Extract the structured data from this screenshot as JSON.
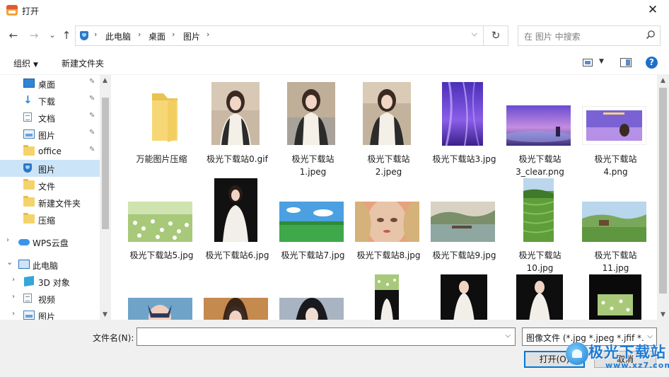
{
  "window": {
    "title": "打开",
    "close_glyph": "✕"
  },
  "nav": {
    "back_glyph": "←",
    "forward_glyph": "→",
    "recent_glyph": "⌄",
    "up_glyph": "↑",
    "breadcrumb": [
      "此电脑",
      "桌面",
      "图片"
    ],
    "crumb_sep": "›",
    "address_dropdown_glyph": "⌵",
    "refresh_glyph": "↻",
    "search_placeholder": "在 图片 中搜索"
  },
  "toolbar": {
    "organize_label": "组织",
    "new_folder_label": "新建文件夹",
    "help_label": "?"
  },
  "sidebar": {
    "items": [
      {
        "label": "桌面",
        "icon": "desktop-icon",
        "pinned": true
      },
      {
        "label": "下载",
        "icon": "download-icon",
        "pinned": true
      },
      {
        "label": "文档",
        "icon": "document-icon",
        "pinned": true
      },
      {
        "label": "图片",
        "icon": "pictures-icon",
        "pinned": true
      },
      {
        "label": "office",
        "icon": "folder-icon",
        "pinned": true
      },
      {
        "label": "图片",
        "icon": "shield-folder-icon",
        "selected": true
      },
      {
        "label": "文件",
        "icon": "folder-icon"
      },
      {
        "label": "新建文件夹",
        "icon": "folder-icon"
      },
      {
        "label": "压缩",
        "icon": "folder-icon"
      },
      {
        "label": "WPS云盘",
        "icon": "cloud-icon",
        "expandable": true
      },
      {
        "label": "此电脑",
        "icon": "computer-icon",
        "expanded": true
      },
      {
        "label": "3D 对象",
        "icon": "cube-icon",
        "expandable": true
      },
      {
        "label": "视频",
        "icon": "video-icon",
        "expandable": true
      },
      {
        "label": "图片",
        "icon": "pictures-icon",
        "expandable": true
      }
    ],
    "pin_glyph": "📌",
    "expand_glyph": "›",
    "collapse_glyph": "⌄"
  },
  "files": [
    {
      "name": "万能图片压缩",
      "kind": "folder"
    },
    {
      "name": "极光下载站0.gif",
      "kind": "photo-portrait"
    },
    {
      "name": "极光下载站\n1.jpeg",
      "kind": "photo-portrait"
    },
    {
      "name": "极光下载站\n2.jpeg",
      "kind": "photo-portrait"
    },
    {
      "name": "极光下载站3.jpg",
      "kind": "purple-sky"
    },
    {
      "name": "极光下载站\n3_clear.png",
      "kind": "purple-landscape"
    },
    {
      "name": "极光下载站\n4.png",
      "kind": "purple-card"
    },
    {
      "name": "极光下载站5.jpg",
      "kind": "flower-field"
    },
    {
      "name": "极光下载站6.jpg",
      "kind": "dark-portrait"
    },
    {
      "name": "极光下载站7.jpg",
      "kind": "anime-field"
    },
    {
      "name": "极光下载站8.jpg",
      "kind": "face-closeup"
    },
    {
      "name": "极光下载站9.jpg",
      "kind": "lake"
    },
    {
      "name": "极光下载站\n10.jpg",
      "kind": "terraces"
    },
    {
      "name": "极光下载站\n11.jpg",
      "kind": "meadow"
    }
  ],
  "bottom": {
    "filename_label": "文件名(N):",
    "filename_value": "",
    "filetype_value": "图像文件 (*.jpg *.jpeg *.jfif *.b",
    "open_label": "打开(O)",
    "cancel_label": "取消"
  },
  "watermark": {
    "text": "极光下载站",
    "url": "www.xz7.com"
  }
}
